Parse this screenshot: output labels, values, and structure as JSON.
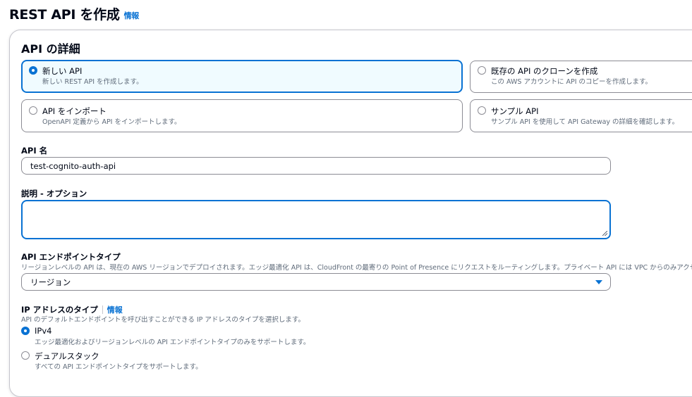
{
  "page": {
    "title": "REST API を作成",
    "info": "情報"
  },
  "details": {
    "heading": "API の詳細",
    "options": [
      {
        "label": "新しい API",
        "desc": "新しい REST API を作成します。",
        "selected": true
      },
      {
        "label": "既存の API のクローンを作成",
        "desc": "この AWS アカウントに API のコピーを作成します。",
        "selected": false
      },
      {
        "label": "API をインポート",
        "desc": "OpenAPI 定義から API をインポートします。",
        "selected": false
      },
      {
        "label": "サンプル API",
        "desc": "サンプル API を使用して API Gateway の詳細を確認します。",
        "selected": false
      }
    ]
  },
  "api_name": {
    "label": "API 名",
    "value": "test-cognito-auth-api"
  },
  "description": {
    "label": "説明 - オプション",
    "value": ""
  },
  "endpoint_type": {
    "label": "API エンドポイントタイプ",
    "desc": "リージョンレベルの API は、現在の AWS リージョンでデプロイされます。エッジ最適化 API は、CloudFront の最寄りの Point of Presence にリクエストをルーティングします。プライベート API には VPC からのみアクセ",
    "value": "リージョン"
  },
  "ip_type": {
    "label": "IP アドレスのタイプ",
    "info": "情報",
    "desc": "API のデフォルトエンドポイントを呼び出すことができる IP アドレスのタイプを選択します。",
    "options": [
      {
        "label": "IPv4",
        "desc": "エッジ最適化およびリージョンレベルの API エンドポイントタイプのみをサポートします。",
        "selected": true
      },
      {
        "label": "デュアルスタック",
        "desc": "すべての API エンドポイントタイプをサポートします。",
        "selected": false
      }
    ]
  }
}
